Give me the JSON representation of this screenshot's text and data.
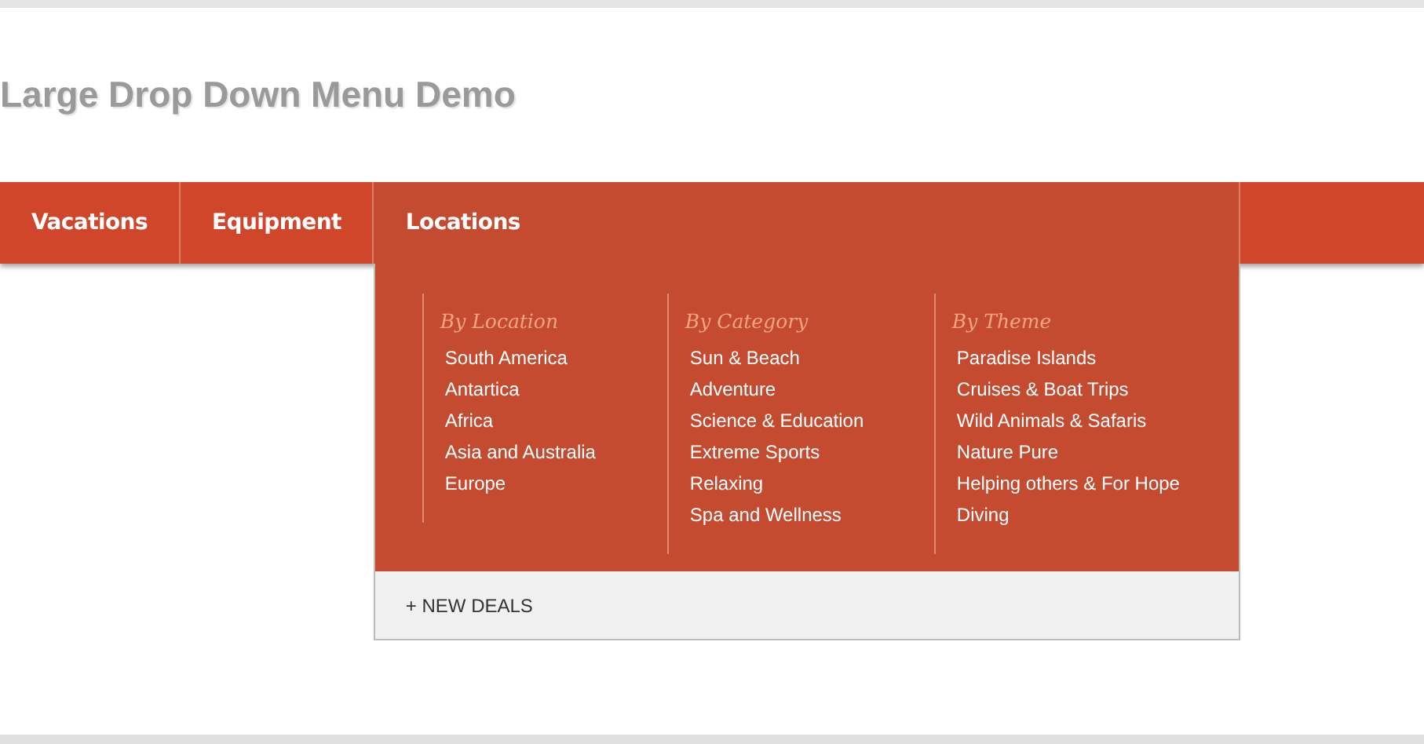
{
  "page_title": "Large Drop Down Menu Demo",
  "nav": [
    {
      "label": "Vacations",
      "selected": false
    },
    {
      "label": "Equipment",
      "selected": false
    },
    {
      "label": "Locations",
      "selected": true
    }
  ],
  "dropdown": {
    "columns": [
      {
        "heading": "By Location",
        "items": [
          "South America",
          "Antartica",
          "Africa",
          "Asia and Australia",
          "Europe"
        ]
      },
      {
        "heading": "By Category",
        "items": [
          "Sun & Beach",
          "Adventure",
          "Science & Education",
          "Extreme Sports",
          "Relaxing",
          "Spa and Wellness"
        ]
      },
      {
        "heading": "By Theme",
        "items": [
          "Paradise Islands",
          "Cruises & Boat Trips",
          "Wild Animals & Safaris",
          "Nature Pure",
          "Helping others & For Hope",
          "Diving"
        ]
      }
    ],
    "footer_link": "+ NEW DEALS"
  }
}
